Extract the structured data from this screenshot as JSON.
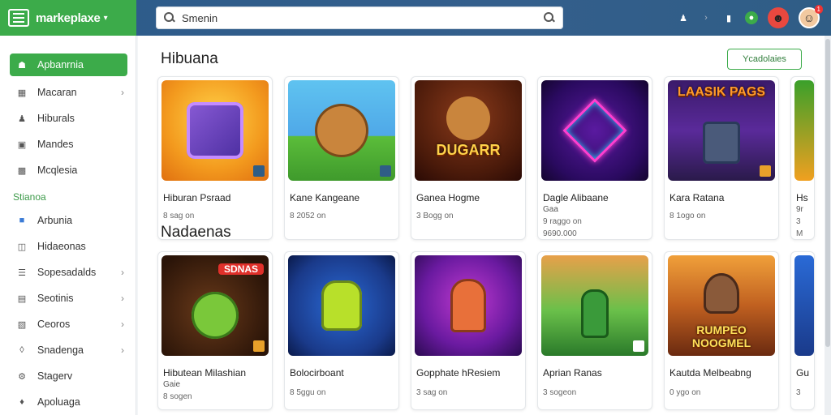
{
  "app": {
    "name": "markeplaxe"
  },
  "search": {
    "placeholder": "Smenin"
  },
  "colors": {
    "accent": "#3cab4a",
    "topbar": "#2f5d86"
  },
  "topbar_icons": [
    "contact-icon",
    "arrow-icon",
    "phone-icon",
    "chat-icon",
    "mascot-icon",
    "avatar-icon"
  ],
  "notification_count": "1",
  "sidebar": {
    "items": [
      {
        "label": "Apbanrnia",
        "icon": "home-icon",
        "active": true
      },
      {
        "label": "Macaran",
        "icon": "grid-icon",
        "arrow": true
      },
      {
        "label": "Hiburals",
        "icon": "people-icon"
      },
      {
        "label": "Mandes",
        "icon": "store-icon"
      },
      {
        "label": "Mcqlesia",
        "icon": "folder-icon"
      }
    ],
    "section": "Stianoa",
    "items2": [
      {
        "label": "Arbunia",
        "icon": "chart-icon"
      },
      {
        "label": "Hidaeonas",
        "icon": "cart-icon"
      },
      {
        "label": "Sopesadalds",
        "icon": "list-icon",
        "arrow": true
      },
      {
        "label": "Seotinis",
        "icon": "doc-icon",
        "arrow": true
      },
      {
        "label": "Ceoros",
        "icon": "book-icon",
        "arrow": true
      },
      {
        "label": "Snadenga",
        "icon": "shield-icon",
        "arrow": true
      },
      {
        "label": "Stagerv",
        "icon": "gear-icon"
      },
      {
        "label": "Apoluaga",
        "icon": "tag-icon"
      }
    ]
  },
  "main": {
    "section1_title": "Hibuana",
    "view_button": "Ycadolaies",
    "section2_title": "Nadaenas",
    "row1": [
      {
        "name": "Hiburan Psraad",
        "meta": "8 sag on"
      },
      {
        "name": "Kane Kangeane",
        "meta": "8 2052 on"
      },
      {
        "name": "Ganea Hogme",
        "meta": "3 Bogg on"
      },
      {
        "name": "Dagle Alibaane",
        "sub": "Gaa",
        "meta": "9 raggo on",
        "meta2": "9690.000"
      },
      {
        "name": "Kara Ratana",
        "meta": "8 1ogo on"
      },
      {
        "name": "Hs",
        "sub": "9r",
        "meta": "3",
        "meta2": "M"
      }
    ],
    "row1_captions": {
      "card3": "DUGARR",
      "card5": "LAASIK PAGS"
    },
    "row2": [
      {
        "name": "Hibutean Milashian",
        "sub": "Gaie",
        "meta": "8 sogen"
      },
      {
        "name": "Bolocirboant",
        "meta": "8 5ggu on"
      },
      {
        "name": "Gopphate hResiem",
        "meta": "3 sag on"
      },
      {
        "name": "Aprian Ranas",
        "meta": "3 sogeon"
      },
      {
        "name": "Kautda Melbeabng",
        "meta": "0 ygo on"
      },
      {
        "name": "Gu",
        "meta": "3"
      }
    ],
    "row2_captions": {
      "card1": "SDNAS",
      "card5": "RUMPEO NOOGMEL"
    }
  }
}
